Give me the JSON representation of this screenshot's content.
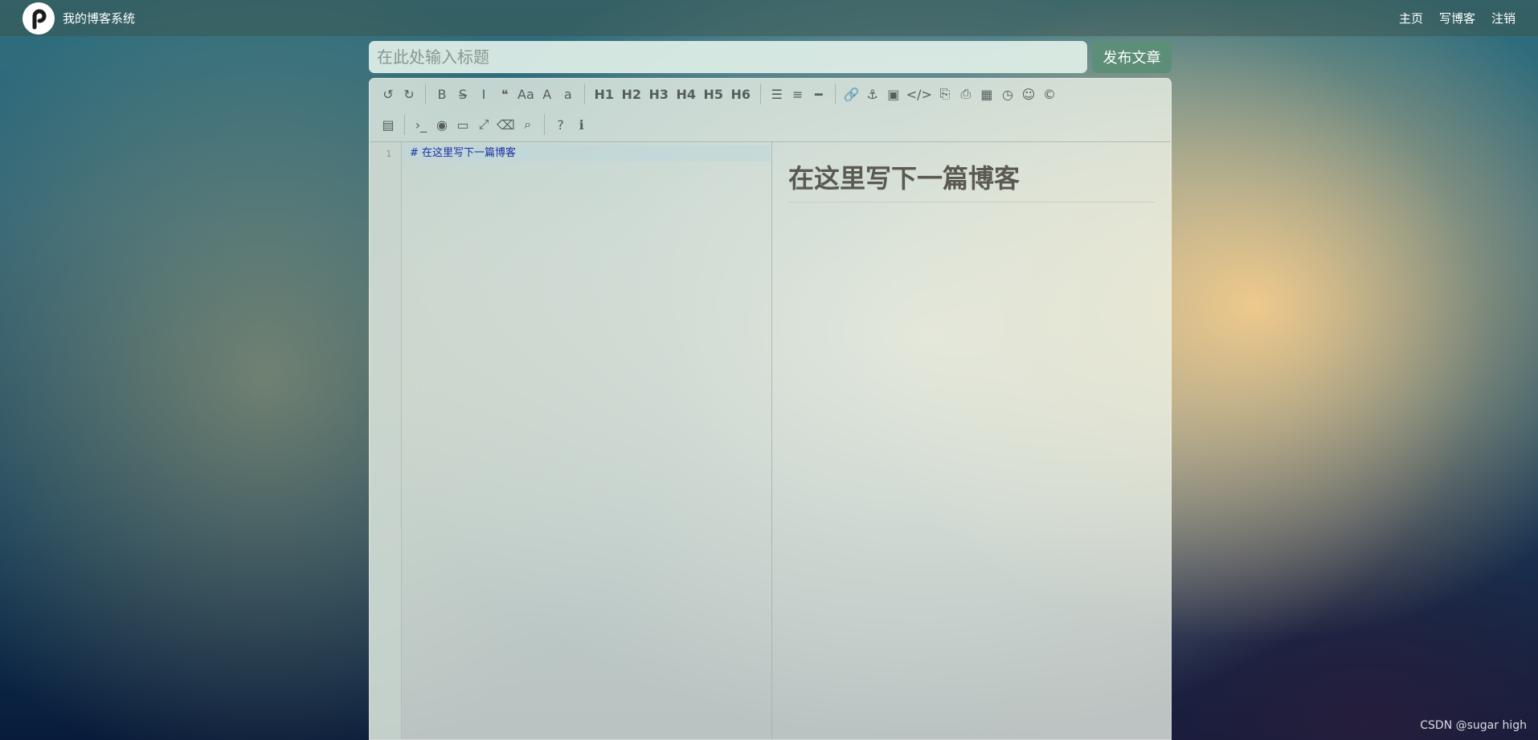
{
  "navbar": {
    "brand": "我的博客系统",
    "links": [
      "主页",
      "写博客",
      "注销"
    ]
  },
  "title_input": {
    "placeholder": "在此处输入标题",
    "value": ""
  },
  "publish_button": "发布文章",
  "toolbar": {
    "row1": [
      {
        "name": "undo-icon",
        "glyph": "↺"
      },
      {
        "name": "redo-icon",
        "glyph": "↻"
      },
      {
        "sep": true
      },
      {
        "name": "bold-icon",
        "glyph": "B"
      },
      {
        "name": "strikethrough-icon",
        "glyph": "S̶"
      },
      {
        "name": "italic-icon",
        "glyph": "I"
      },
      {
        "name": "quote-icon",
        "glyph": "❝"
      },
      {
        "name": "uppercase-icon",
        "glyph": "Aa"
      },
      {
        "name": "uppercase-first-icon",
        "glyph": "A"
      },
      {
        "name": "lowercase-icon",
        "glyph": "a"
      },
      {
        "sep": true
      },
      {
        "name": "h1-button",
        "glyph": "H1",
        "hd": true
      },
      {
        "name": "h2-button",
        "glyph": "H2",
        "hd": true
      },
      {
        "name": "h3-button",
        "glyph": "H3",
        "hd": true
      },
      {
        "name": "h4-button",
        "glyph": "H4",
        "hd": true
      },
      {
        "name": "h5-button",
        "glyph": "H5",
        "hd": true
      },
      {
        "name": "h6-button",
        "glyph": "H6",
        "hd": true
      },
      {
        "sep": true
      },
      {
        "name": "unordered-list-icon",
        "glyph": "☰"
      },
      {
        "name": "ordered-list-icon",
        "glyph": "≡"
      },
      {
        "name": "horizontal-rule-icon",
        "glyph": "━"
      },
      {
        "sep": true
      },
      {
        "name": "link-icon",
        "glyph": "🔗"
      },
      {
        "name": "anchor-icon",
        "glyph": "⚓"
      },
      {
        "name": "image-icon",
        "glyph": "▣"
      },
      {
        "name": "code-icon",
        "glyph": "</>"
      },
      {
        "name": "preformatted-code-icon",
        "glyph": "⎘"
      },
      {
        "name": "code-block-icon",
        "glyph": "⎙"
      },
      {
        "name": "table-icon",
        "glyph": "▦"
      },
      {
        "name": "datetime-icon",
        "glyph": "◷"
      },
      {
        "name": "emoji-icon",
        "glyph": "☺"
      },
      {
        "name": "html-entities-icon",
        "glyph": "©"
      }
    ],
    "row2": [
      {
        "name": "goto-line-icon",
        "glyph": "▤"
      },
      {
        "sep": true
      },
      {
        "name": "watch-toggle-icon",
        "glyph": "›_"
      },
      {
        "name": "unwatch-icon",
        "glyph": "◉"
      },
      {
        "name": "preview-icon",
        "glyph": "▭"
      },
      {
        "name": "fullscreen-icon",
        "glyph": "⤢"
      },
      {
        "name": "clear-icon",
        "glyph": "⌫"
      },
      {
        "name": "search-icon",
        "glyph": "⌕"
      },
      {
        "sep": true
      },
      {
        "name": "help-icon",
        "glyph": "?"
      },
      {
        "name": "info-icon",
        "glyph": "ℹ"
      }
    ]
  },
  "editor": {
    "line_number": "1",
    "code_line": "# 在这里写下一篇博客"
  },
  "preview": {
    "heading": "在这里写下一篇博客"
  },
  "watermark": "CSDN @sugar high"
}
